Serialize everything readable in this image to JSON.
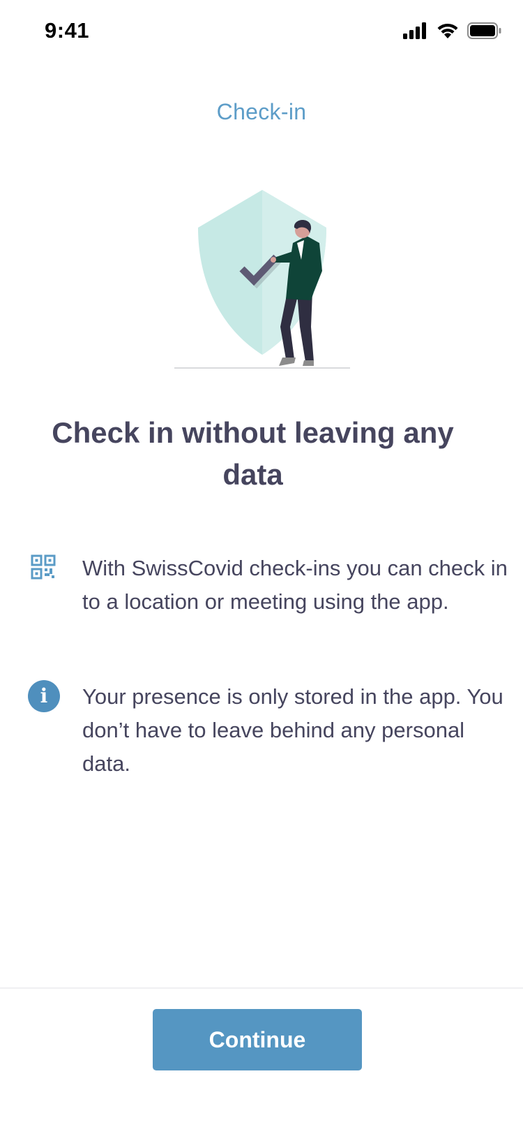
{
  "status_bar": {
    "time": "9:41",
    "icons": [
      "cellular-signal-icon",
      "wifi-icon",
      "battery-icon"
    ]
  },
  "nav": {
    "title": "Check-in"
  },
  "illustration": {
    "description_icon": "shield-person-illustration"
  },
  "headline": "Check in without leaving any data",
  "info_rows": [
    {
      "icon": "qr-code-icon",
      "text": "With SwissCovid check-ins you can check in to a location or meeting using the app."
    },
    {
      "icon": "info-icon",
      "icon_glyph": "i",
      "text": "Your presence is only stored in the app. You don’t have to leave behind any personal data."
    }
  ],
  "footer": {
    "continue_label": "Continue"
  },
  "colors": {
    "accent": "#5596c2",
    "nav_title": "#5d9dc8",
    "text": "#46455e",
    "shield": "#c6e9e5",
    "jacket": "#0f4438"
  }
}
